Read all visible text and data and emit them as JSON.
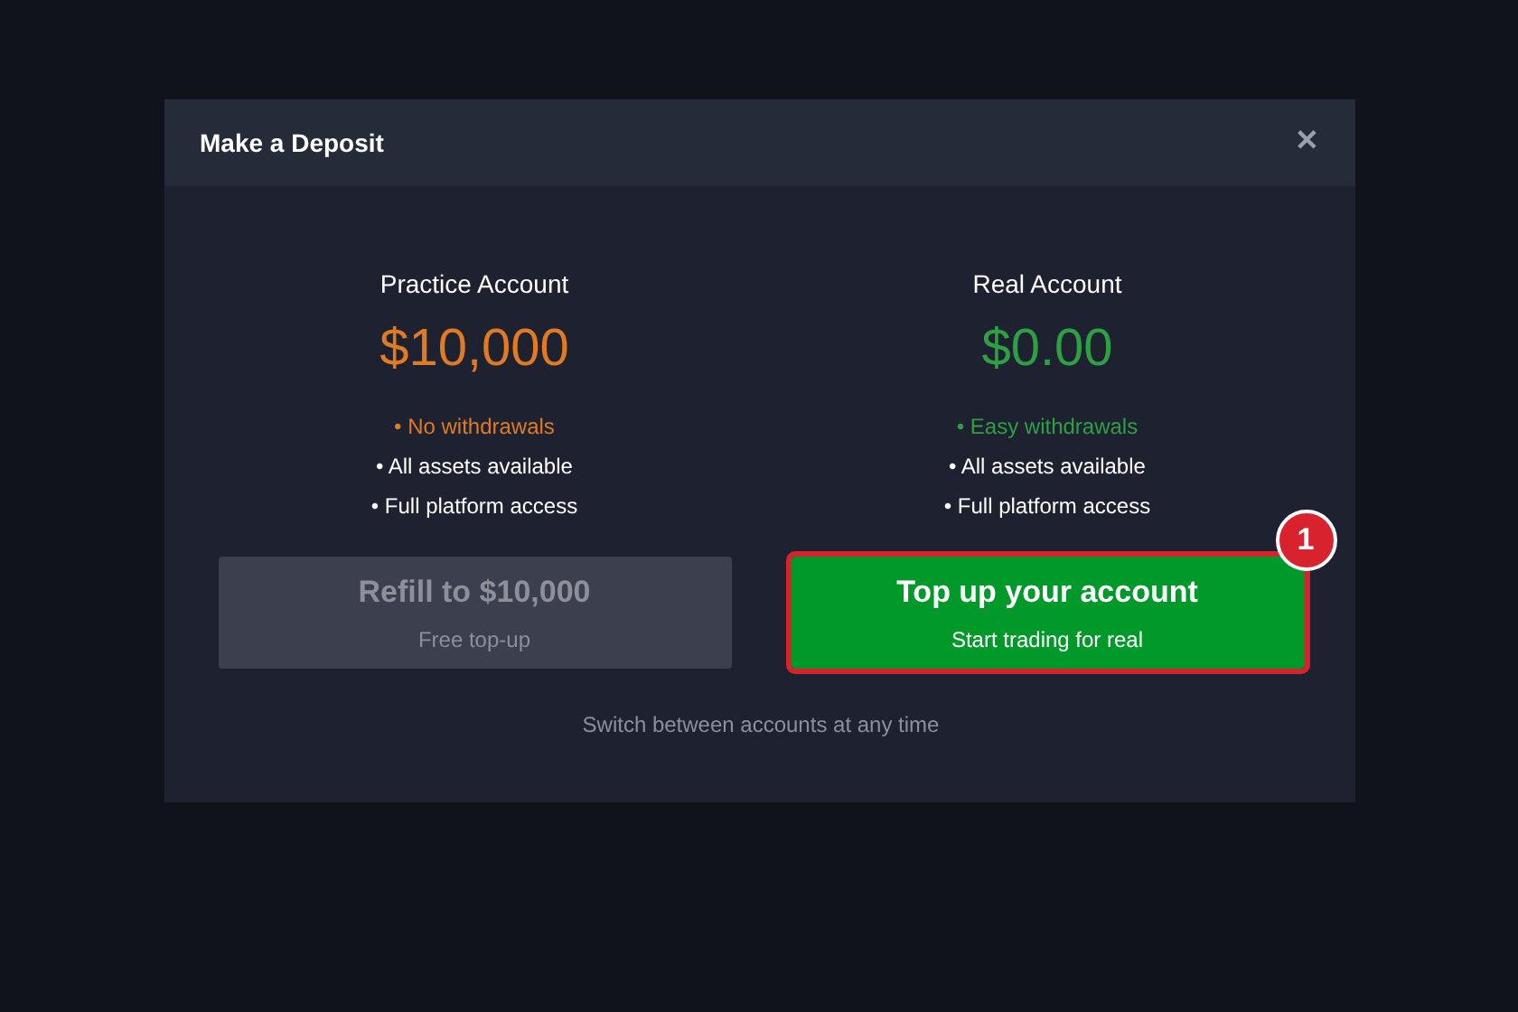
{
  "dialog": {
    "title": "Make a Deposit",
    "close": "✕"
  },
  "accounts": [
    {
      "name": "Practice Account",
      "balance": "$10,000",
      "color": "#e07b24",
      "features": [
        {
          "text": "• No withdrawals",
          "highlighted": true
        },
        {
          "text": "• All assets available",
          "highlighted": false
        },
        {
          "text": "• Full platform access",
          "highlighted": false
        }
      ],
      "button": {
        "label": "Refill to $10,000",
        "sublabel": "Free top-up",
        "disabled": true,
        "annotated": false
      }
    },
    {
      "name": "Real Account",
      "balance": "$0.00",
      "color": "#2ea043",
      "features": [
        {
          "text": "• Easy withdrawals",
          "highlighted": true
        },
        {
          "text": "• All assets available",
          "highlighted": false
        },
        {
          "text": "• Full platform access",
          "highlighted": false
        }
      ],
      "button": {
        "label": "Top up your account",
        "sublabel": "Start trading for real",
        "disabled": false,
        "annotated": true,
        "annotation": "1"
      }
    }
  ],
  "footer_note": "Switch between accounts at any time"
}
